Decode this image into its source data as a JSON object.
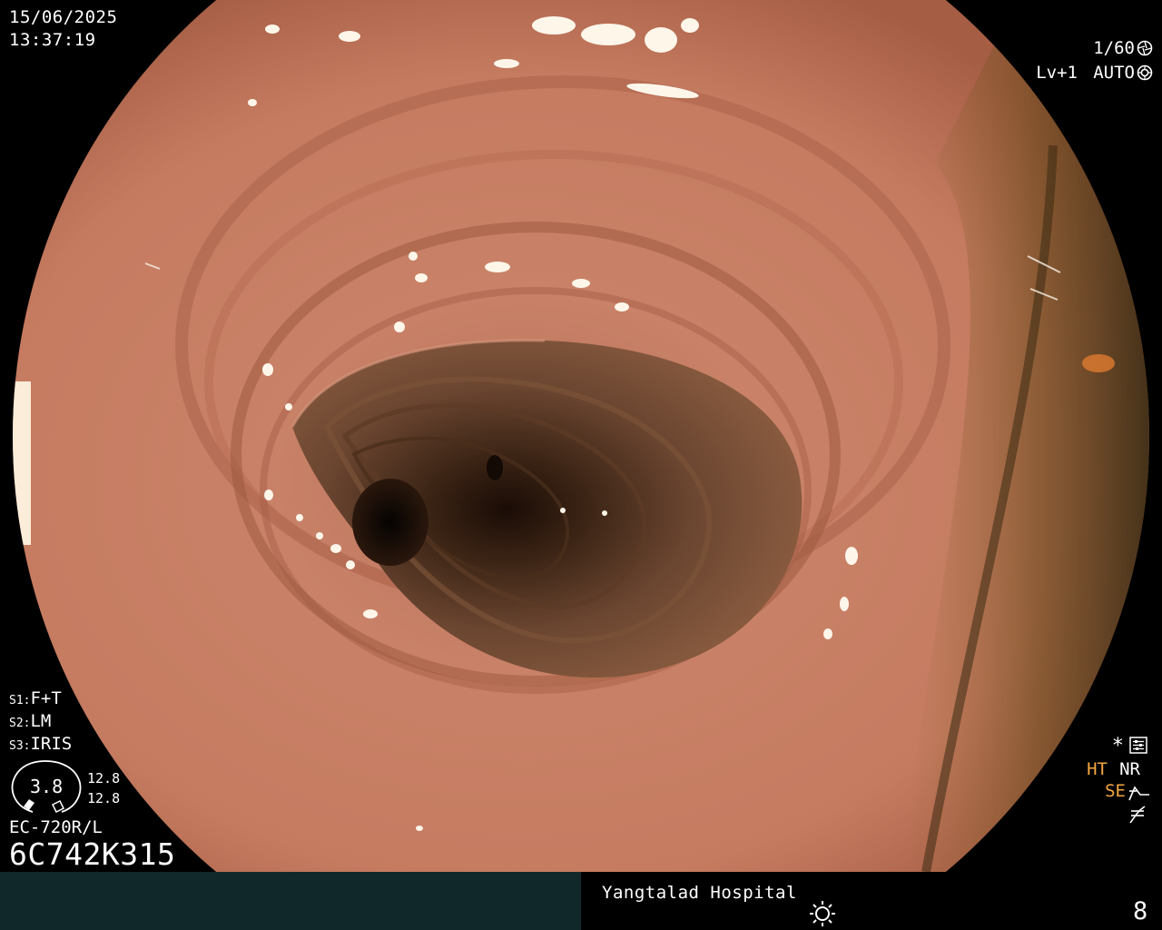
{
  "overlay": {
    "date": "15/06/2025",
    "time": "13:37:19",
    "shutter": "1/60",
    "level": "Lv+1",
    "exposure_mode": "AUTO",
    "scope_settings": [
      {
        "key": "S1:",
        "value": "F+T"
      },
      {
        "key": "S2:",
        "value": "LM"
      },
      {
        "key": "S3:",
        "value": "IRIS"
      }
    ],
    "gauge_value": "3.8",
    "gauge_top": "12.8",
    "gauge_bottom": "12.8",
    "model": "EC-720R/L",
    "serial": "6C742K315",
    "asterisk": "*",
    "ht": "HT",
    "nr": "NR",
    "se": "SE"
  },
  "bottom_bar": {
    "hospital": "Yangtalad Hospital",
    "page_number": "8"
  },
  "icons": {
    "shutter": "aperture-icon",
    "auto": "auto-exposure-icon",
    "menu": "settings-menu-icon",
    "se": "structure-enhancement-icon",
    "freeze": "freeze-icon",
    "brightness": "brightness-icon"
  },
  "colors": {
    "accent": "#f4a640",
    "bottom_bar_left": "#11282a"
  }
}
